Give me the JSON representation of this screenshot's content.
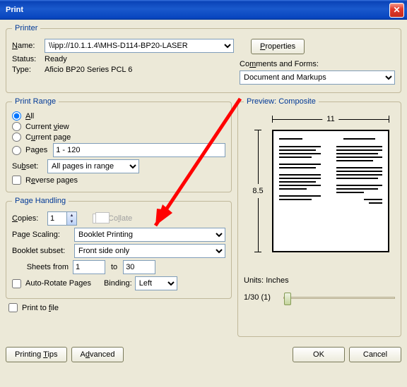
{
  "window": {
    "title": "Print"
  },
  "printer": {
    "legend": "Printer",
    "name_label": "Name:",
    "name_value": "\\\\ipp://10.1.1.4\\MHS-D114-BP20-LASER",
    "status_label": "Status:",
    "status_value": "Ready",
    "type_label": "Type:",
    "type_value": "Aficio BP20 Series PCL 6",
    "properties_btn": "Properties",
    "comments_label": "Comments and Forms:",
    "comments_value": "Document and Markups"
  },
  "range": {
    "legend": "Print Range",
    "all": "All",
    "current_view": "Current view",
    "current_page": "Current page",
    "pages": "Pages",
    "pages_value": "1 - 120",
    "subset_label": "Subset:",
    "subset_value": "All pages in range",
    "reverse": "Reverse pages"
  },
  "handling": {
    "legend": "Page Handling",
    "copies_label": "Copies:",
    "copies_value": "1",
    "collate": "Collate",
    "scaling_label": "Page Scaling:",
    "scaling_value": "Booklet Printing",
    "subset_label": "Booklet subset:",
    "subset_value": "Front side only",
    "sheets_from": "Sheets from",
    "sheets_from_val": "1",
    "sheets_to": "to",
    "sheets_to_val": "30",
    "auto_rotate": "Auto-Rotate Pages",
    "binding_label": "Binding:",
    "binding_value": "Left"
  },
  "preview": {
    "legend": "Preview: Composite",
    "width": "11",
    "height": "8.5",
    "units_label": "Units:",
    "units_value": "Inches",
    "progress": "1/30 (1)"
  },
  "misc": {
    "print_to_file": "Print to file",
    "printing_tips": "Printing Tips",
    "advanced": "Advanced",
    "ok": "OK",
    "cancel": "Cancel"
  }
}
